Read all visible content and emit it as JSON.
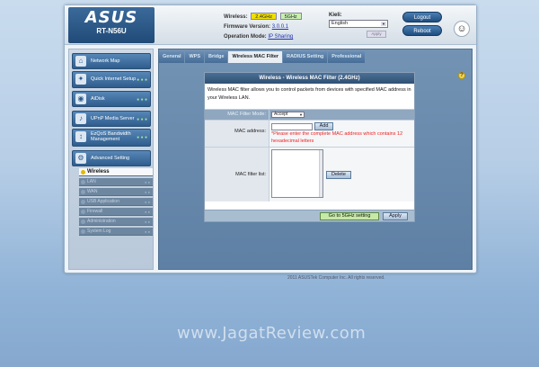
{
  "header": {
    "brand": "ASUS",
    "model": "RT-N56U",
    "wireless_label": "Wireless:",
    "band_24": "2.4GHz",
    "band_5": "5GHz",
    "firmware_label": "Firmware Version:",
    "firmware_value": "3.0.0.1",
    "opmode_label": "Operation Mode:",
    "opmode_value": "IP Sharing",
    "lang_label": "Kieli:",
    "lang_value": "English",
    "lang_apply": "Apply",
    "logout": "Logout",
    "reboot": "Reboot"
  },
  "sidebar": {
    "menus": [
      {
        "label": "Network Map",
        "icon": "network-icon"
      },
      {
        "label": "Quick Internet Setup",
        "icon": "wizard-icon"
      },
      {
        "label": "AiDisk",
        "icon": "disk-icon"
      },
      {
        "label": "UPnP Media Server",
        "icon": "media-icon"
      },
      {
        "label": "EzQoS Bandwidth Management",
        "icon": "qos-icon"
      },
      {
        "label": "Advanced Setting",
        "icon": "gear-icon"
      }
    ],
    "sub": [
      "Wireless",
      "LAN",
      "WAN",
      "USB Application",
      "Firewall",
      "Administration",
      "System Log"
    ]
  },
  "tabs": [
    "General",
    "WPS",
    "Bridge",
    "Wireless MAC Filter",
    "RADIUS Setting",
    "Professional"
  ],
  "panel": {
    "title": "Wireless - Wireless MAC Filter (2.4GHz)",
    "desc": "Wireless MAC filter allows you to control packets from devices with specified MAC address in your Wireless LAN.",
    "mode_label": "MAC Filter Mode:",
    "mode_value": "Accept",
    "mac_label": "MAC address:",
    "add_btn": "Add",
    "warning": "*Please enter the complete MAC address which contains 12 hexadecimal letters",
    "list_label": "MAC filter list:",
    "delete_btn": "Delete",
    "goto5g_btn": "Go to 5GHz setting",
    "apply_btn": "Apply"
  },
  "footer": {
    "copyright": "2011 ASUSTek Computer Inc. All rights reserved."
  },
  "watermark": "www.JagatReview.com"
}
